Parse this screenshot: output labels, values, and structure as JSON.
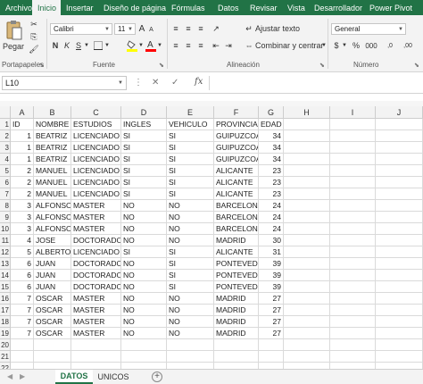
{
  "ribbon_tabs": [
    "Archivo",
    "Inicio",
    "Insertar",
    "Diseño de página",
    "Fórmulas",
    "Datos",
    "Revisar",
    "Vista",
    "Desarrollador",
    "Power Pivot"
  ],
  "active_tab": "Inicio",
  "clipboard": {
    "paste_label": "Pegar",
    "group_label": "Portapapeles"
  },
  "font": {
    "name": "Calibri",
    "size": "11",
    "bold": "N",
    "italic": "K",
    "underline": "S",
    "grow": "A",
    "shrink": "A",
    "group_label": "Fuente"
  },
  "alignment": {
    "wrap_label": "Ajustar texto",
    "merge_label": "Combinar y centrar",
    "group_label": "Alineación"
  },
  "number": {
    "format": "General",
    "currency": "$",
    "percent": "%",
    "thousands": "000",
    "dec_increase": ",0",
    "dec_decrease": ",00",
    "group_label": "Número"
  },
  "formula_bar": {
    "name_box": "L10",
    "fx": "fx",
    "cancel": "✕",
    "confirm": "✓",
    "formula": ""
  },
  "colors": {
    "accent": "#217346",
    "fill_highlight": "#ffff00",
    "font_color": "#ff0000"
  },
  "columns": [
    "A",
    "B",
    "C",
    "D",
    "E",
    "F",
    "G",
    "H",
    "I",
    "J"
  ],
  "rows": [
    [
      "ID",
      "NOMBRE",
      "ESTUDIOS",
      "INGLES",
      "VEHICULO",
      "PROVINCIA",
      "EDAD"
    ],
    [
      "1",
      "BEATRIZ",
      "LICENCIADO",
      "SI",
      "SI",
      "GUIPUZCOA",
      "34"
    ],
    [
      "1",
      "BEATRIZ",
      "LICENCIADO",
      "SI",
      "SI",
      "GUIPUZCOA",
      "34"
    ],
    [
      "1",
      "BEATRIZ",
      "LICENCIADO",
      "SI",
      "SI",
      "GUIPUZCOA",
      "34"
    ],
    [
      "2",
      "MANUEL",
      "LICENCIADO",
      "SI",
      "SI",
      "ALICANTE",
      "23"
    ],
    [
      "2",
      "MANUEL",
      "LICENCIADO",
      "SI",
      "SI",
      "ALICANTE",
      "23"
    ],
    [
      "2",
      "MANUEL",
      "LICENCIADO",
      "SI",
      "SI",
      "ALICANTE",
      "23"
    ],
    [
      "3",
      "ALFONSO",
      "MASTER",
      "NO",
      "NO",
      "BARCELONA",
      "24"
    ],
    [
      "3",
      "ALFONSO",
      "MASTER",
      "NO",
      "NO",
      "BARCELONA",
      "24"
    ],
    [
      "3",
      "ALFONSO",
      "MASTER",
      "NO",
      "NO",
      "BARCELONA",
      "24"
    ],
    [
      "4",
      "JOSE",
      "DOCTORADO",
      "NO",
      "NO",
      "MADRID",
      "30"
    ],
    [
      "5",
      "ALBERTO",
      "LICENCIADO",
      "SI",
      "SI",
      "ALICANTE",
      "31"
    ],
    [
      "6",
      "JUAN",
      "DOCTORADO",
      "NO",
      "SI",
      "PONTEVEDRA",
      "39"
    ],
    [
      "6",
      "JUAN",
      "DOCTORADO",
      "NO",
      "SI",
      "PONTEVEDRA",
      "39"
    ],
    [
      "6",
      "JUAN",
      "DOCTORADO",
      "NO",
      "SI",
      "PONTEVEDRA",
      "39"
    ],
    [
      "7",
      "OSCAR",
      "MASTER",
      "NO",
      "NO",
      "MADRID",
      "27"
    ],
    [
      "7",
      "OSCAR",
      "MASTER",
      "NO",
      "NO",
      "MADRID",
      "27"
    ],
    [
      "7",
      "OSCAR",
      "MASTER",
      "NO",
      "NO",
      "MADRID",
      "27"
    ],
    [
      "7",
      "OSCAR",
      "MASTER",
      "NO",
      "NO",
      "MADRID",
      "27"
    ],
    [],
    []
  ],
  "row_numbers": [
    "1",
    "2",
    "3",
    "4",
    "5",
    "6",
    "7",
    "8",
    "9",
    "10",
    "11",
    "12",
    "13",
    "14",
    "15",
    "16",
    "17",
    "18",
    "19",
    "20",
    "21",
    "22"
  ],
  "sheets": [
    "DATOS",
    "UNICOS"
  ],
  "active_sheet": "DATOS",
  "add_sheet": "+"
}
